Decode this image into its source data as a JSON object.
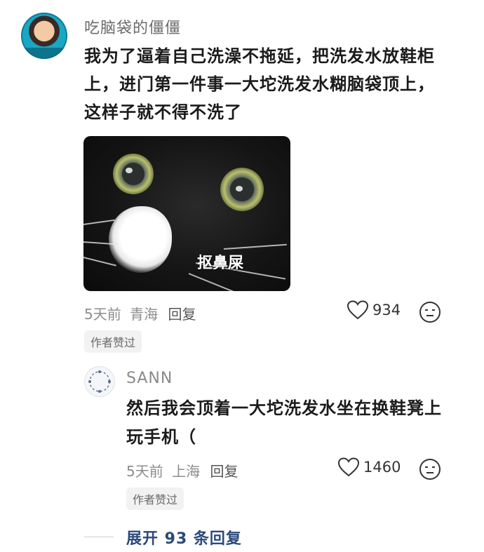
{
  "comment": {
    "username": "吃脑袋的僵僵",
    "text": "我为了逼着自己洗澡不拖延，把洗发水放鞋柜上，进门第一件事一大坨洗发水糊脑袋顶上，这样子就不得不洗了",
    "image_caption": "抠鼻屎",
    "time": "5天前",
    "location": "青海",
    "reply_label": "回复",
    "like_count": "934",
    "author_badge": "作者赞过"
  },
  "reply": {
    "username": "SANN",
    "text": "然后我会顶着一大坨洗发水坐在换鞋凳上玩手机（",
    "time": "5天前",
    "location": "上海",
    "reply_label": "回复",
    "like_count": "1460",
    "author_badge": "作者赞过"
  },
  "expand": {
    "label": "展开 93 条回复"
  },
  "icons": [
    "heart-icon",
    "dislike-face-icon"
  ],
  "colors": {
    "expand_link": "#2b4a7a",
    "meta_text": "#8c8c8c"
  }
}
